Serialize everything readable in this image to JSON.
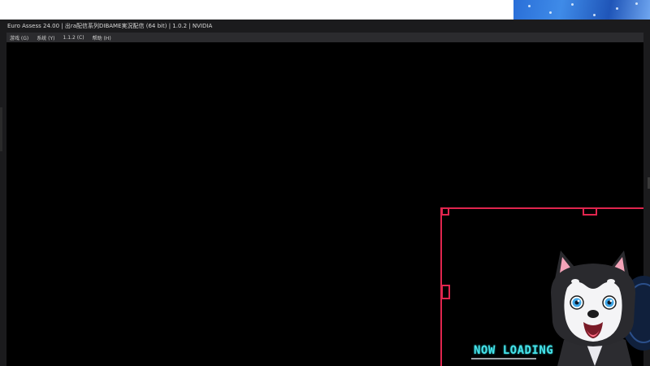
{
  "window": {
    "title": "Euro Assess 24.00 | 出ra配信系列DIBAME実況配信 (64 bit) | 1.0.2 | NVIDIA"
  },
  "menu": {
    "items": [
      {
        "label": "游戏 (G)"
      },
      {
        "label": "系统 (Y)"
      },
      {
        "label": "1.1.2 (C)"
      },
      {
        "label": "帮助 (H)"
      }
    ]
  },
  "overlay": {
    "loading_text": "NOW LOADING"
  },
  "colors": {
    "hud_frame": "#e0254e",
    "loading_text": "#46e3ea",
    "viewport_bg": "#000000",
    "titlebar_bg": "#1b1b1d"
  },
  "icons": {
    "avatar": "husky-vtuber-avatar",
    "corner": "decorative-corner-art"
  }
}
